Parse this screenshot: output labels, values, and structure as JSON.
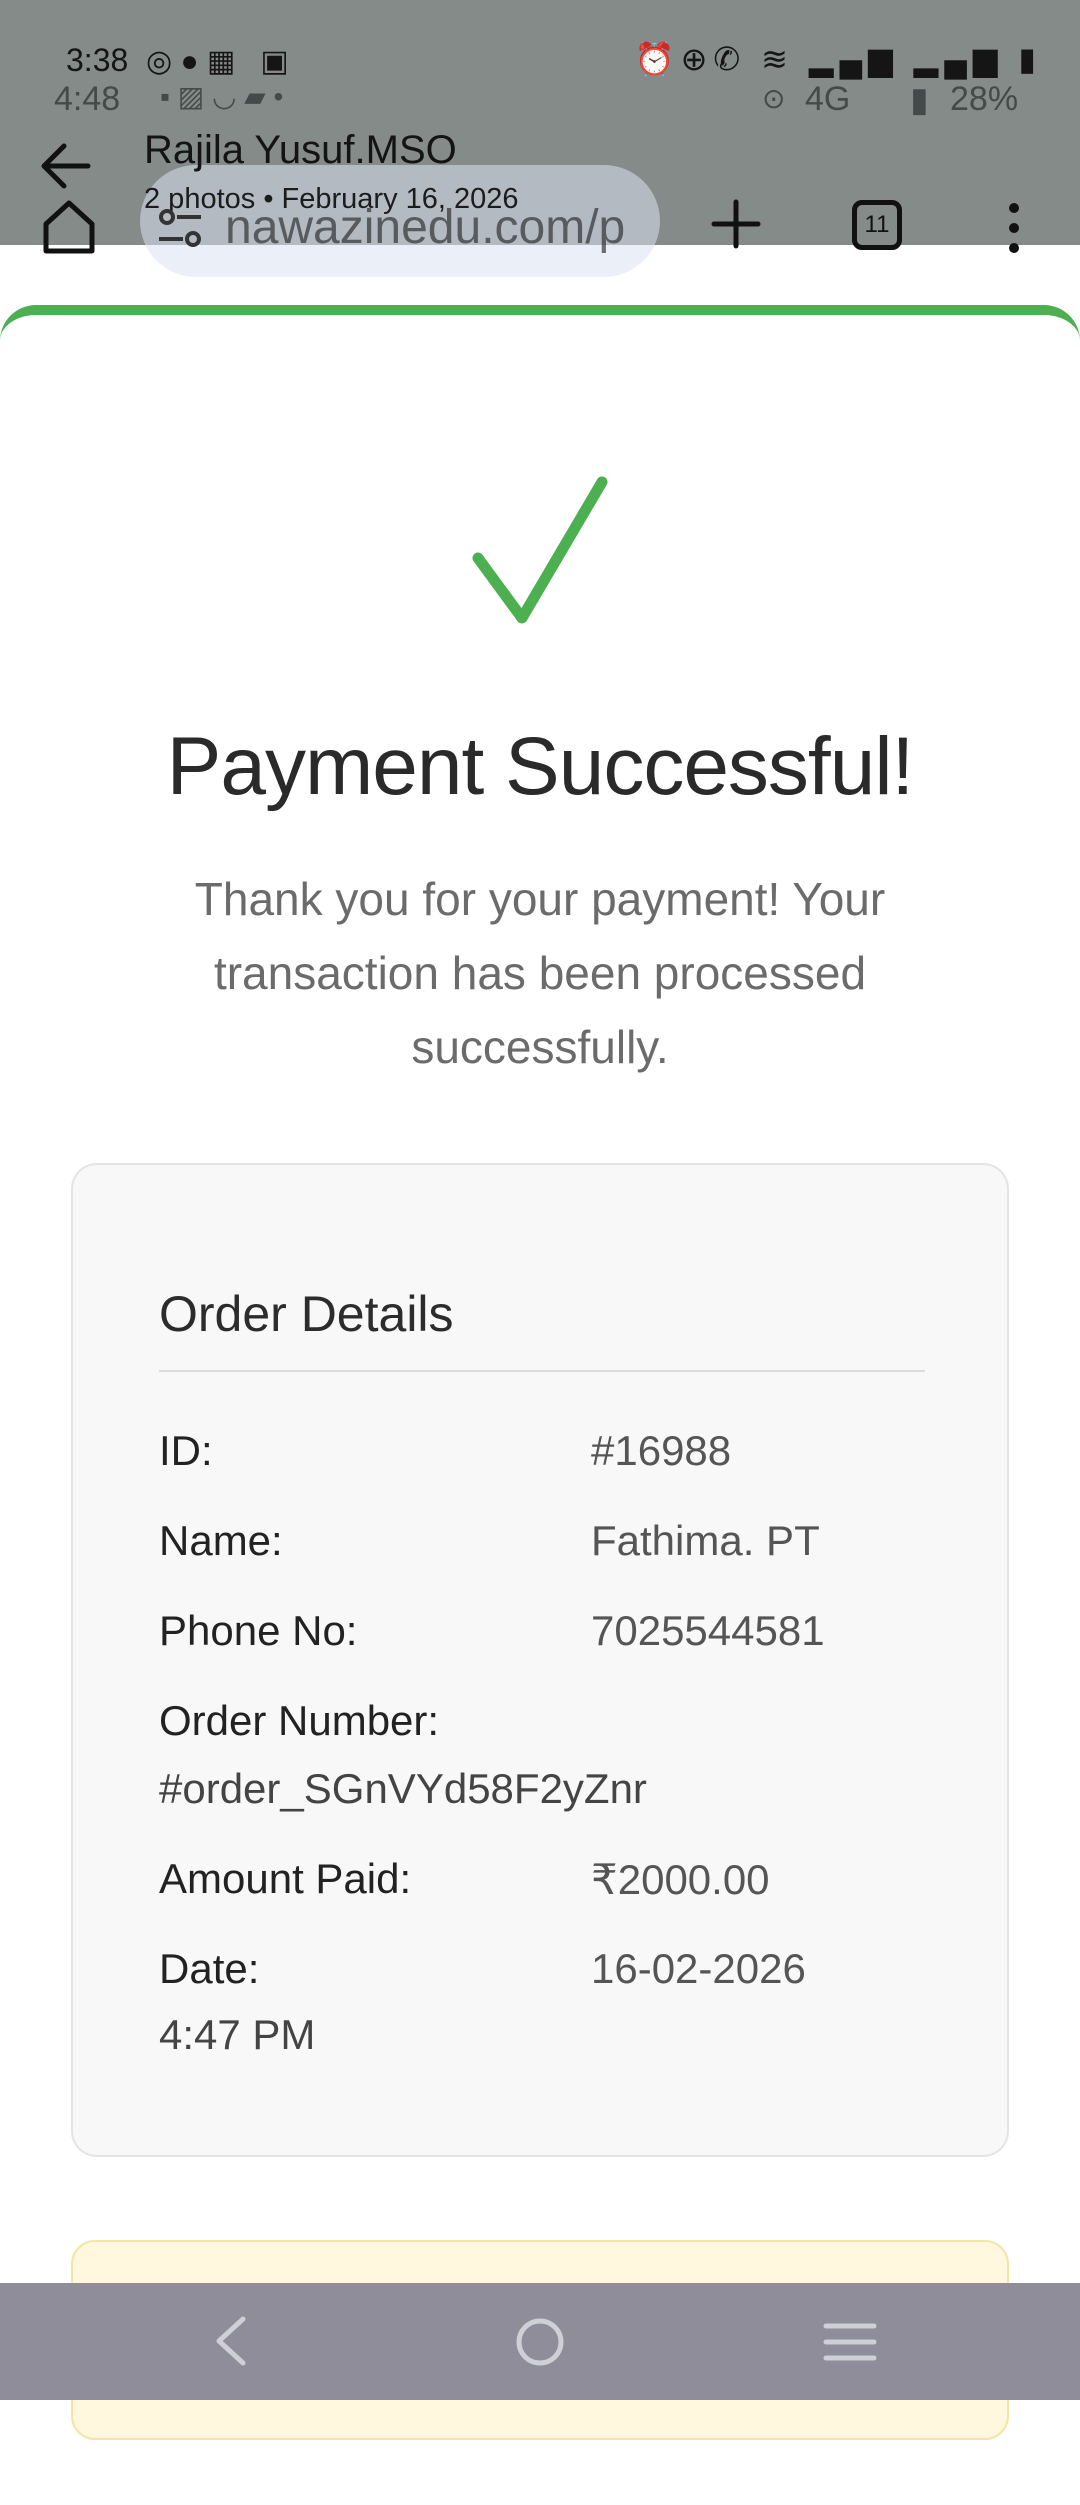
{
  "status_bar": {
    "time": "3:38",
    "ghost_time": "4:48",
    "ghost_network": "4G",
    "ghost_battery": "28%",
    "icons": [
      "whatsapp-icon",
      "messenger-icon",
      "app-icon",
      "record-icon",
      "alarm-icon",
      "data-saver-icon",
      "wifi-calling-icon",
      "wifi-icon",
      "signal-icon",
      "signal-icon",
      "battery-low-icon"
    ]
  },
  "gallery_header": {
    "title": "Rajila Yusuf.MSO",
    "subtitle": "2 photos  •  February 16, 2026"
  },
  "browser": {
    "url": "nawazinedu.com/p",
    "tab_count": "11"
  },
  "payment": {
    "heading": "Payment Successful!",
    "message": "Thank you for your payment! Your transaction has been processed successfully.",
    "accent_color": "#4caf50"
  },
  "order_details": {
    "title": "Order Details",
    "id_label": "ID:",
    "id_value": "#16988",
    "name_label": "Name:",
    "name_value": "Fathima. PT",
    "phone_label": "Phone No:",
    "phone_value": "7025544581",
    "order_number_label": "Order Number:",
    "order_number_value": "#order_SGnVYd58F2yZnr",
    "amount_label": "Amount Paid:",
    "amount_value": "₹2000.00",
    "date_label": "Date:",
    "date_value": "16-02-2026",
    "time_value": "4:47 PM"
  }
}
